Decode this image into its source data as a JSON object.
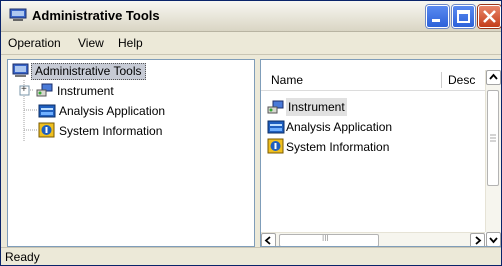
{
  "window": {
    "title": "Administrative Tools",
    "icon": "computer-icon"
  },
  "titlebar_buttons": {
    "minimize": "minimize-icon",
    "maximize": "maximize-icon",
    "close": "close-icon"
  },
  "menu": {
    "items": [
      "Operation",
      "View",
      "Help"
    ]
  },
  "tree": {
    "root": {
      "label": "Administrative Tools",
      "icon": "computer-icon"
    },
    "children": [
      {
        "label": "Instrument",
        "icon": "instrument-icon",
        "expander": "+"
      },
      {
        "label": "Analysis Application",
        "icon": "analysis-app-icon"
      },
      {
        "label": "System Information",
        "icon": "system-info-icon"
      }
    ]
  },
  "list": {
    "columns": [
      "Name",
      "Desc"
    ],
    "items": [
      {
        "label": "Instrument",
        "icon": "instrument-icon"
      },
      {
        "label": "Analysis Application",
        "icon": "analysis-app-icon"
      },
      {
        "label": "System Information",
        "icon": "system-info-icon"
      }
    ]
  },
  "scroll_glyph": "III",
  "status": {
    "text": "Ready"
  },
  "colors": {
    "title_close": "#c43d1a",
    "title_btn": "#2d62d9",
    "selection": "#c7cbd5",
    "border": "#7f9db9"
  }
}
